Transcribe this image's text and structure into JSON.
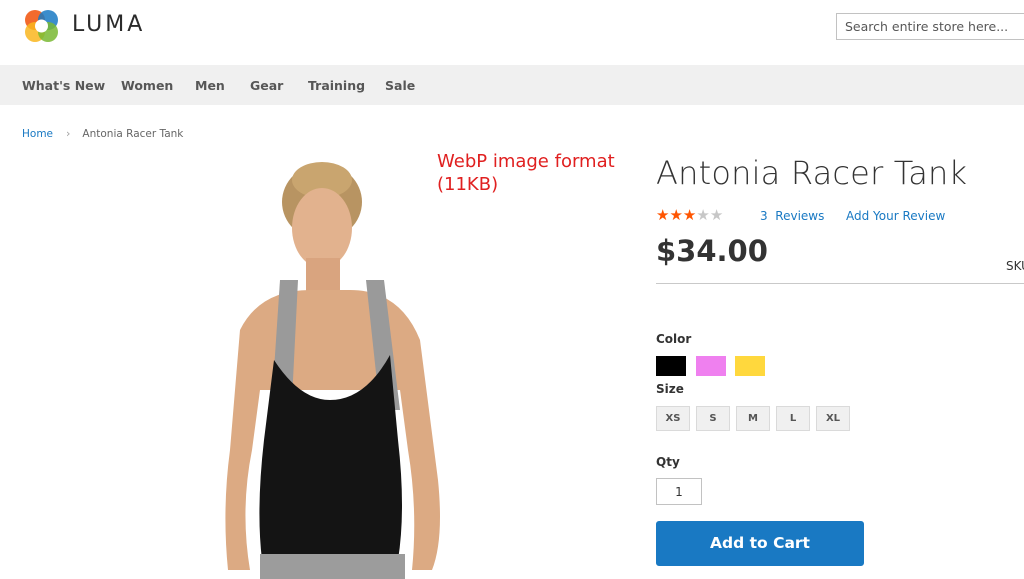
{
  "header": {
    "logo_text": "LUMA",
    "search_placeholder": "Search entire store here..."
  },
  "nav": {
    "items": [
      "What's New",
      "Women",
      "Men",
      "Gear",
      "Training",
      "Sale"
    ]
  },
  "breadcrumb": {
    "home": "Home",
    "separator": "›",
    "current": "Antonia Racer Tank"
  },
  "annotation": {
    "line1": "WebP image format",
    "line2": "(11KB)"
  },
  "product": {
    "title": "Antonia Racer Tank",
    "rating_stars_filled": 3,
    "rating_stars_total": 5,
    "review_count": "3",
    "reviews_label": "Reviews",
    "add_review": "Add Your Review",
    "price": "$34.00",
    "sku_label": "SKU",
    "color_label": "Color",
    "colors": [
      "#000000",
      "#ef80ef",
      "#ffd83d"
    ],
    "size_label": "Size",
    "sizes": [
      "XS",
      "S",
      "M",
      "L",
      "XL"
    ],
    "qty_label": "Qty",
    "qty_value": "1",
    "add_to_cart": "Add to Cart"
  },
  "colors": {
    "accent": "#1979c3",
    "star": "#ff5501",
    "nav_bg": "#f0f0f0",
    "annotation": "#e02020"
  }
}
